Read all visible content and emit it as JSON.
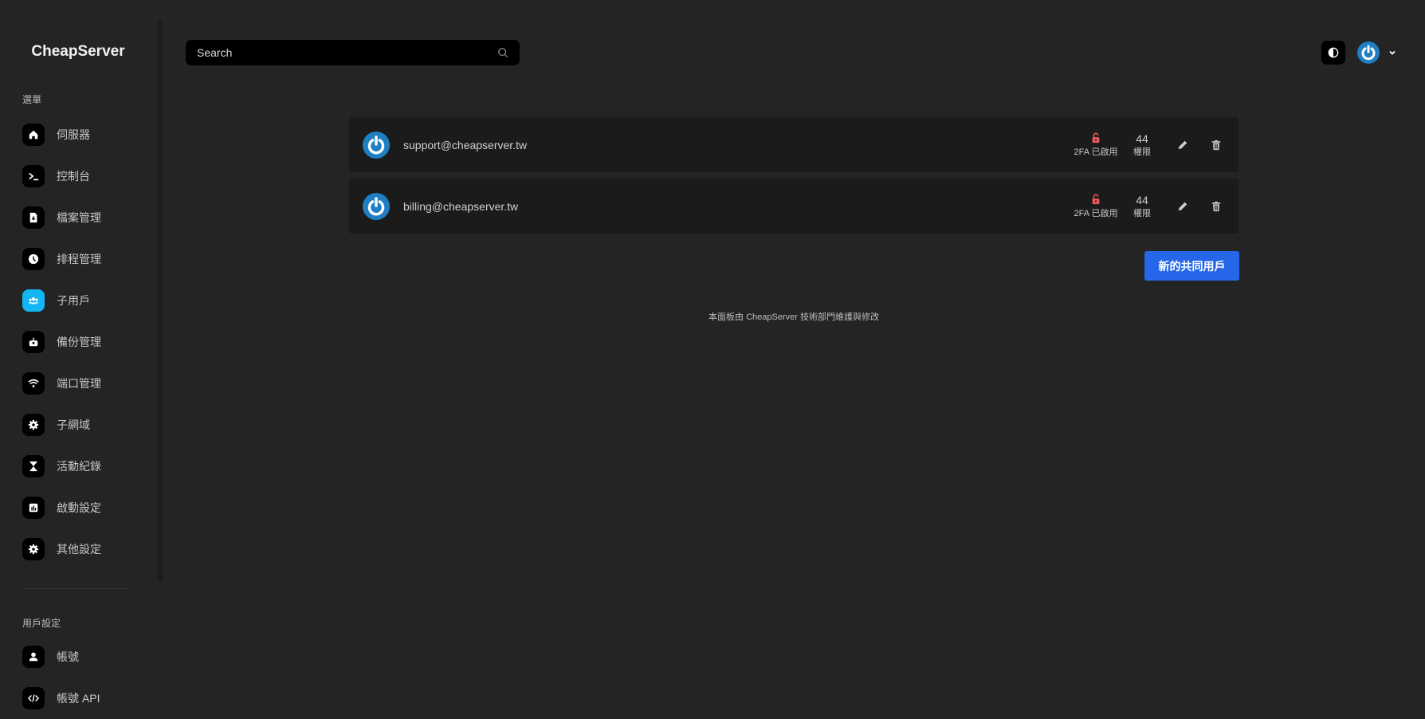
{
  "brand": "CheapServer",
  "sidebar": {
    "menu_label": "選單",
    "items": [
      {
        "label": "伺服器",
        "icon": "home-icon"
      },
      {
        "label": "控制台",
        "icon": "terminal-icon"
      },
      {
        "label": "檔案管理",
        "icon": "file-icon"
      },
      {
        "label": "排程管理",
        "icon": "clock-icon"
      },
      {
        "label": "子用戶",
        "icon": "users-icon",
        "active": true
      },
      {
        "label": "備份管理",
        "icon": "backup-icon"
      },
      {
        "label": "端口管理",
        "icon": "wifi-icon"
      },
      {
        "label": "子網域",
        "icon": "gear-icon"
      },
      {
        "label": "活動紀錄",
        "icon": "hourglass-icon"
      },
      {
        "label": "啟動設定",
        "icon": "chart-icon"
      },
      {
        "label": "其他設定",
        "icon": "gear-icon"
      }
    ],
    "user_label": "用戶設定",
    "user_items": [
      {
        "label": "帳號",
        "icon": "user-icon"
      },
      {
        "label": "帳號 API",
        "icon": "code-icon"
      }
    ]
  },
  "header": {
    "search_placeholder": "Search"
  },
  "subusers": [
    {
      "email": "support@cheapserver.tw",
      "tfa_label": "2FA 已啟用",
      "permissions": "44",
      "permissions_label": "權限"
    },
    {
      "email": "billing@cheapserver.tw",
      "tfa_label": "2FA 已啟用",
      "permissions": "44",
      "permissions_label": "權限"
    }
  ],
  "new_user_button": "新的共同用戶",
  "footer": "本面板由 CheapServer 技術部門維護與修改",
  "colors": {
    "accent": "#12b6f3",
    "primary_button": "#2567e8",
    "lock_icon": "#e85a5a",
    "avatar": "#1f7fc2"
  }
}
